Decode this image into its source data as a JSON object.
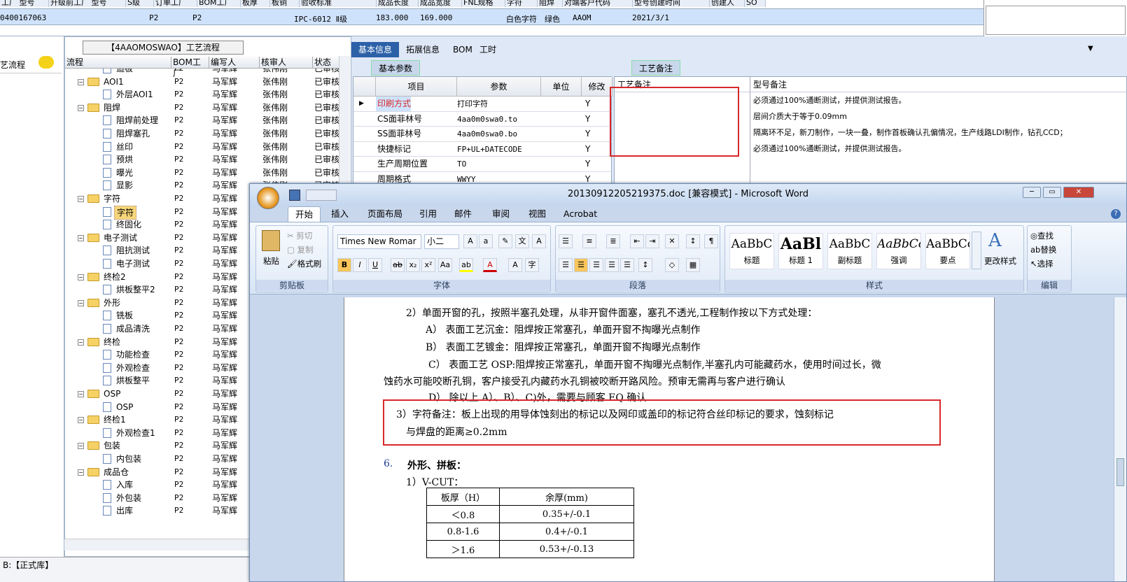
{
  "top_grid": {
    "headers": [
      "工厂 型号",
      "升级前工厂 型号",
      "S级",
      "订单工厂",
      "BOM工厂",
      "板厚",
      "板铜",
      "验收标准",
      "成品长度",
      "成品宽度",
      "FNL规格",
      "字符",
      "阻焊",
      "对端客户代码",
      "型号创建时间",
      "创建人",
      "SO"
    ],
    "row": {
      "id": "0400167063",
      "c1": "P2",
      "c2": "P2",
      "standard": "IPC-6012 Ⅱ级",
      "length": "183.000",
      "width": "169.000",
      "char": "白色字符",
      "mask": "绿色",
      "cust": "AAOM",
      "date": "2021/3/1"
    }
  },
  "left_pane": {
    "label": "艺流程"
  },
  "tree_pane": {
    "title": "【4AAOMOSWAO】工艺流程",
    "headers": [
      "流程",
      "BOM工厂",
      "编写人",
      "核审人",
      "状态"
    ],
    "rows": [
      {
        "name": "造板",
        "bom": "P2",
        "w": "马军辉",
        "r": "张伟刚",
        "s": "已审核",
        "lvl": 2
      },
      {
        "name": "AOI1",
        "bom": "P2",
        "w": "马军辉",
        "r": "张伟刚",
        "s": "已审核",
        "lvl": 1
      },
      {
        "name": "外层AOI1",
        "bom": "P2",
        "w": "马军辉",
        "r": "张伟刚",
        "s": "已审核",
        "lvl": 2
      },
      {
        "name": "阻焊",
        "bom": "P2",
        "w": "马军辉",
        "r": "张伟刚",
        "s": "已审核",
        "lvl": 1
      },
      {
        "name": "阻焊前处理",
        "bom": "P2",
        "w": "马军辉",
        "r": "张伟刚",
        "s": "已审核",
        "lvl": 2
      },
      {
        "name": "阻焊塞孔",
        "bom": "P2",
        "w": "马军辉",
        "r": "张伟刚",
        "s": "已审核",
        "lvl": 2
      },
      {
        "name": "丝印",
        "bom": "P2",
        "w": "马军辉",
        "r": "张伟刚",
        "s": "已审核",
        "lvl": 2
      },
      {
        "name": "预烘",
        "bom": "P2",
        "w": "马军辉",
        "r": "张伟刚",
        "s": "已审核",
        "lvl": 2
      },
      {
        "name": "曝光",
        "bom": "P2",
        "w": "马军辉",
        "r": "张伟刚",
        "s": "已审核",
        "lvl": 2
      },
      {
        "name": "显影",
        "bom": "P2",
        "w": "马军辉",
        "r": "张伟刚",
        "s": "已审核",
        "lvl": 2
      },
      {
        "name": "字符",
        "bom": "P2",
        "w": "马军辉",
        "r": "",
        "s": "",
        "lvl": 1
      },
      {
        "name": "字符",
        "bom": "P2",
        "w": "马军辉",
        "r": "",
        "s": "",
        "lvl": 2,
        "sel": true
      },
      {
        "name": "终固化",
        "bom": "P2",
        "w": "马军辉",
        "r": "",
        "s": "",
        "lvl": 2
      },
      {
        "name": "电子测试",
        "bom": "P2",
        "w": "马军辉",
        "r": "",
        "s": "",
        "lvl": 1
      },
      {
        "name": "阻抗测试",
        "bom": "P2",
        "w": "马军辉",
        "r": "",
        "s": "",
        "lvl": 2
      },
      {
        "name": "电子测试",
        "bom": "P2",
        "w": "马军辉",
        "r": "",
        "s": "",
        "lvl": 2
      },
      {
        "name": "终检2",
        "bom": "P2",
        "w": "马军辉",
        "r": "",
        "s": "",
        "lvl": 1
      },
      {
        "name": "烘板整平2",
        "bom": "P2",
        "w": "马军辉",
        "r": "",
        "s": "",
        "lvl": 2
      },
      {
        "name": "外形",
        "bom": "P2",
        "w": "马军辉",
        "r": "",
        "s": "",
        "lvl": 1
      },
      {
        "name": "铣板",
        "bom": "P2",
        "w": "马军辉",
        "r": "",
        "s": "",
        "lvl": 2
      },
      {
        "name": "成品清洗",
        "bom": "P2",
        "w": "马军辉",
        "r": "",
        "s": "",
        "lvl": 2
      },
      {
        "name": "终检",
        "bom": "P2",
        "w": "马军辉",
        "r": "",
        "s": "",
        "lvl": 1
      },
      {
        "name": "功能检查",
        "bom": "P2",
        "w": "马军辉",
        "r": "",
        "s": "",
        "lvl": 2
      },
      {
        "name": "外观检查",
        "bom": "P2",
        "w": "马军辉",
        "r": "",
        "s": "",
        "lvl": 2
      },
      {
        "name": "烘板整平",
        "bom": "P2",
        "w": "马军辉",
        "r": "",
        "s": "",
        "lvl": 2
      },
      {
        "name": "OSP",
        "bom": "P2",
        "w": "马军辉",
        "r": "",
        "s": "",
        "lvl": 1
      },
      {
        "name": "OSP",
        "bom": "P2",
        "w": "马军辉",
        "r": "",
        "s": "",
        "lvl": 2
      },
      {
        "name": "终检1",
        "bom": "P2",
        "w": "马军辉",
        "r": "",
        "s": "",
        "lvl": 1
      },
      {
        "name": "外观检查1",
        "bom": "P2",
        "w": "马军辉",
        "r": "",
        "s": "",
        "lvl": 2
      },
      {
        "name": "包装",
        "bom": "P2",
        "w": "马军辉",
        "r": "",
        "s": "",
        "lvl": 1
      },
      {
        "name": "内包装",
        "bom": "P2",
        "w": "马军辉",
        "r": "",
        "s": "",
        "lvl": 2
      },
      {
        "name": "成品仓",
        "bom": "P2",
        "w": "马军辉",
        "r": "",
        "s": "",
        "lvl": 1
      },
      {
        "name": "入库",
        "bom": "P2",
        "w": "马军辉",
        "r": "",
        "s": "",
        "lvl": 2
      },
      {
        "name": "外包装",
        "bom": "P2",
        "w": "马军辉",
        "r": "",
        "s": "",
        "lvl": 2
      },
      {
        "name": "出库",
        "bom": "P2",
        "w": "马军辉",
        "r": "",
        "s": "",
        "lvl": 2
      }
    ]
  },
  "status_bar": {
    "text": "B:【正式库】"
  },
  "mid_pane": {
    "tabs": [
      "基本信息",
      "拓展信息",
      "BOM",
      "工时"
    ],
    "sub_tab_left": "基本参数",
    "sub_tab_right": "工艺备注",
    "param_headers": [
      "项目",
      "参数",
      "单位",
      "修改"
    ],
    "params": [
      {
        "item": "印刷方式",
        "val": "打印字符",
        "unit": "",
        "mod": "Y",
        "red": true
      },
      {
        "item": "CS面菲林号",
        "val": "4aa0m0swa0.to",
        "unit": "",
        "mod": "Y"
      },
      {
        "item": "SS面菲林号",
        "val": "4aa0m0swa0.bo",
        "unit": "",
        "mod": "Y"
      },
      {
        "item": "快捷标记",
        "val": "FP+UL+DATECODE",
        "unit": "",
        "mod": "Y"
      },
      {
        "item": "生产周期位置",
        "val": "TO",
        "unit": "",
        "mod": "Y"
      },
      {
        "item": "周期格式",
        "val": "WWYY",
        "unit": "",
        "mod": "Y"
      }
    ],
    "remark_headers": [
      "工艺备注",
      "型号备注"
    ],
    "model_remarks": [
      "必须通过100%通断测试，并提供测试报告。",
      "层间介质大于等于0.09mm",
      "隔离环不足，新刀制作，一块一叠，制作首板确认孔偏情况，生产线路LDI制作，钻孔CCD；",
      "必须通过100%通断测试，并提供测试报告。"
    ]
  },
  "word": {
    "title": "20130912205219375.doc [兼容模式] - Microsoft Word",
    "tabs": [
      "开始",
      "插入",
      "页面布局",
      "引用",
      "邮件",
      "审阅",
      "视图",
      "Acrobat"
    ],
    "clipboard": {
      "paste": "粘贴",
      "cut": "剪切",
      "copy": "复制",
      "format": "格式刷",
      "label": "剪贴板"
    },
    "font": {
      "name": "Times New Romar",
      "size": "小二",
      "label": "字体"
    },
    "paragraph_label": "段落",
    "styles": [
      {
        "sample": "AaBbC",
        "name": "标题"
      },
      {
        "sample": "AaBl",
        "name": "标题 1"
      },
      {
        "sample": "AaBbC",
        "name": "副标题"
      },
      {
        "sample": "AaBbCcDc",
        "name": "强调"
      },
      {
        "sample": "AaBbCcD",
        "name": "要点"
      }
    ],
    "styles_label": "样式",
    "change_styles": "更改样式",
    "editing": {
      "find": "查找",
      "replace": "替换",
      "select": "选择",
      "label": "编辑"
    },
    "doc_lines": [
      "2）单面开窗的孔，按照半塞孔处理，从非开窗件面塞，塞孔不透光,工程制作按以下方式处理：",
      "A） 表面工艺沉金：阻焊按正常塞孔，单面开窗不掏曝光点制作",
      "B） 表面工艺镀金：阻焊按正常塞孔，单面开窗不掏曝光点制作",
      "C） 表面工艺 OSP:阻焊按正常塞孔，单面开窗不掏曝光点制作,半塞孔内可能藏药水，使用时间过长，微",
      "蚀药水可能咬断孔铜，客户接受孔内藏药水孔铜被咬断开路风险。预审无需再与客户进行确认",
      "D） 除以上 A）、B）、C)外，需要与顾客 EQ 确认",
      "3）字符备注：板上出现的用导体蚀刻出的标记以及网印或盖印的标记符合丝印标记的要求，蚀刻标记",
      "与焊盘的距离≥0.2mm"
    ],
    "section_num": "6.",
    "section_title": "外形、拼板：",
    "vcut_label": "1）V-CUT：",
    "table": {
      "headers": [
        "板厚（H）",
        "余厚(mm)"
      ],
      "rows": [
        [
          "＜0.8",
          "0.35+/-0.1"
        ],
        [
          "0.8-1.6",
          "0.4+/-0.1"
        ],
        [
          "＞1.6",
          "0.53+/-0.13"
        ]
      ]
    }
  },
  "colors": {
    "accent": "#2c61a8",
    "highlight": "#d8282a",
    "selection": "#cfe2fb"
  }
}
